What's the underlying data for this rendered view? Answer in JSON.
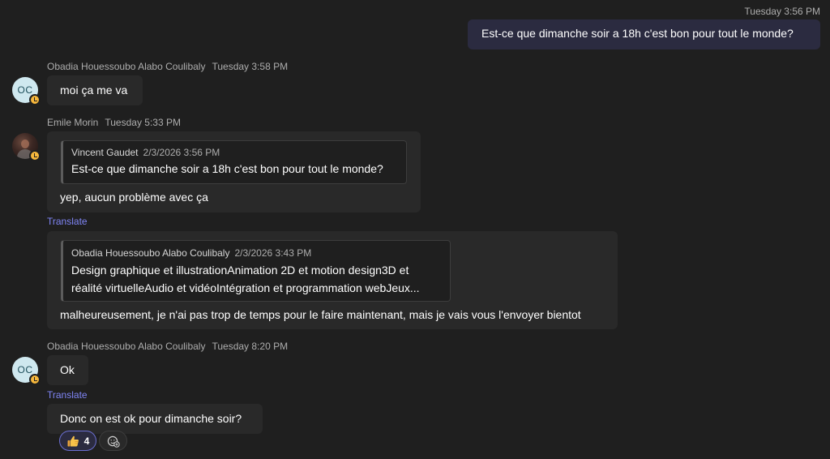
{
  "messages": {
    "m1": {
      "timestamp": "Tuesday 3:56 PM",
      "text": "Est-ce que dimanche soir a 18h c'est bon pour tout le monde?"
    },
    "m2": {
      "sender": "Obadia Houessoubo Alabo Coulibaly",
      "timestamp": "Tuesday 3:58 PM",
      "avatar_initials": "OC",
      "text": "moi ça me va"
    },
    "m3": {
      "sender": "Emile Morin",
      "timestamp": "Tuesday 5:33 PM",
      "quote": {
        "author": "Vincent Gaudet",
        "date": "2/3/2026 3:56 PM",
        "text": "Est-ce que dimanche soir a 18h c'est bon pour tout le monde?"
      },
      "text": "yep, aucun problème avec ça",
      "translate_label": "Translate"
    },
    "m4": {
      "quote": {
        "author": "Obadia Houessoubo Alabo Coulibaly",
        "date": "2/3/2026 3:43 PM",
        "line1": "Design graphique et illustrationAnimation 2D et motion design3D et",
        "line2": "réalité virtuelleAudio et vidéoIntégration et programmation webJeux..."
      },
      "text": "malheureusement, je n'ai pas trop de temps pour le faire maintenant, mais je vais vous l'envoyer bientot"
    },
    "m5": {
      "sender": "Obadia Houessoubo Alabo Coulibaly",
      "timestamp": "Tuesday 8:20 PM",
      "avatar_initials": "OC",
      "text": "Ok",
      "translate_label": "Translate"
    },
    "m6": {
      "text": "Donc on est ok pour dimanche soir?",
      "reactions": [
        {
          "emoji": "thumbs-up",
          "count": "4"
        }
      ]
    }
  },
  "colors": {
    "background": "#1f1f1f",
    "bubble": "#292929",
    "own_bubble": "#2b2b40",
    "link": "#7f85f5",
    "presence_away": "#f6b73c"
  }
}
